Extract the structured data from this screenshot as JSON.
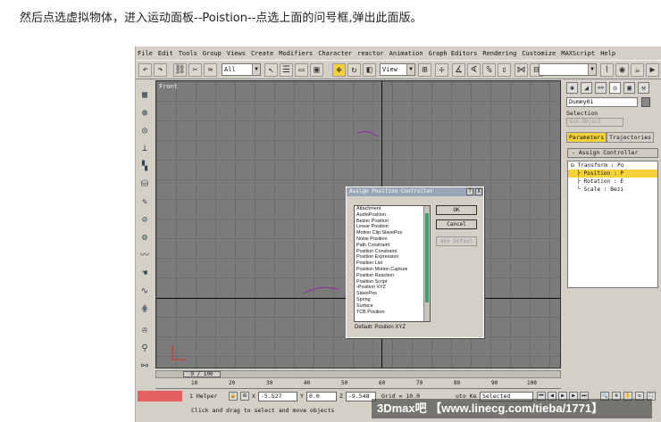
{
  "caption": "然后点选虚拟物体，进入运动面板--Poistion--点选上面的问号框,弹出此面版。",
  "menu": [
    "File",
    "Edit",
    "Tools",
    "Group",
    "Views",
    "Create",
    "Modifiers",
    "Character",
    "reactor",
    "Animation",
    "Graph Editors",
    "Rendering",
    "Customize",
    "MAXScript",
    "Help"
  ],
  "toolbar": {
    "filter_value": "All",
    "refcoord_value": "View"
  },
  "viewport": {
    "label": "Front"
  },
  "dialog": {
    "title": "Assign Position Controller",
    "help_glyph": "?",
    "close_glyph": "X",
    "items": [
      "Attachment",
      "AudioPosition",
      "Bezier Position",
      "Linear Position",
      "Motion Clip SlavePos",
      "Noise Position",
      "Path Constraint",
      "Position Constraint",
      "Position Expression",
      "Position List",
      "Position Motion Capture",
      "Position Reaction",
      "Position Script",
      "›Position XYZ",
      "SlavePos",
      "Spring",
      "Surface",
      "TCB Position"
    ],
    "ok_label": "OK",
    "cancel_label": "Cancel",
    "make_default_label": "ake Defaul",
    "default_text": "Default: Position XYZ"
  },
  "command_panel": {
    "object_name": "Dummy01",
    "selection_label": "Selection",
    "sub_object_label": "Sub-Object",
    "tab_parameters": "Parameters",
    "tab_trajectories": "Trajectories",
    "rollout_title": "Assign Controller",
    "tree": [
      "Transform : Po",
      "Position : P",
      "Rotation : E",
      "Scale : Bezi"
    ]
  },
  "timeline": {
    "frame_text": "0 / 100",
    "ruler": [
      "10",
      "20",
      "30",
      "40",
      "50",
      "60",
      "70",
      "80",
      "90",
      "100"
    ]
  },
  "status": {
    "selected_text": "1 Helper",
    "x_label": "X",
    "x_value": "-5.527",
    "y_label": "Y",
    "y_value": "0.0",
    "z_label": "Z",
    "z_value": "-9.548",
    "grid_text": "Grid = 10.0",
    "autokey_text": "uto Ke",
    "selected_dropdown": "Selected",
    "prompt": "Click and drag to select and move objects"
  },
  "watermark": "3Dmax吧 【www.linecg.com/tieba/1771】"
}
